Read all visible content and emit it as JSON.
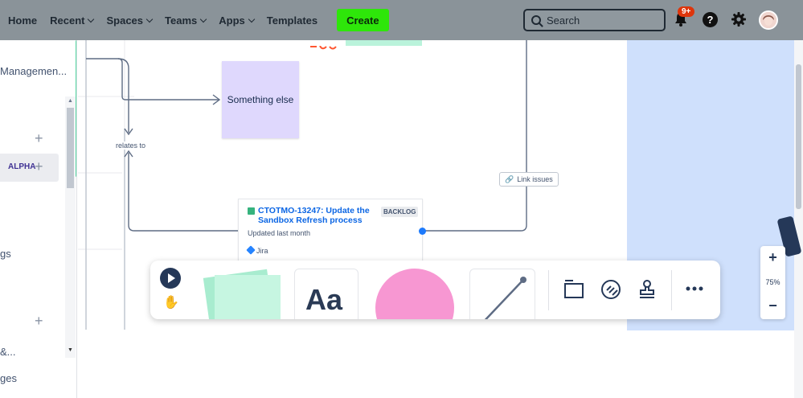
{
  "nav": {
    "home": "Home",
    "recent": "Recent",
    "spaces": "Spaces",
    "teams": "Teams",
    "apps": "Apps",
    "templates": "Templates",
    "create": "Create",
    "search_placeholder": "Search",
    "notifications_badge": "9+",
    "help": "?"
  },
  "sidebar": {
    "item_management": "Managemen...",
    "alpha_badge": "ALPHA",
    "item_gs": "gs",
    "item_amp": "&...",
    "item_ges": "ges"
  },
  "whiteboard": {
    "sticky_note": "Something else",
    "connector_label": "relates to",
    "link_issues": "Link issues",
    "jira_card": {
      "key_title": "CTOTMO-13247: Update the Sandbox Refresh process",
      "status": "BACKLOG",
      "updated": "Updated last month",
      "source": "Jira"
    }
  },
  "zoom": {
    "plus": "+",
    "level": "75%",
    "minus": "−"
  },
  "colors": {
    "nav_bg": "#8a9399",
    "create_btn": "#2ee60a",
    "sticky_purple": "#dfd8fd",
    "sticky_green": "#baf3db",
    "shape_pink": "#f797d2",
    "canvas_panel_blue": "#cfe0fc",
    "jira_link": "#0c66e4"
  }
}
